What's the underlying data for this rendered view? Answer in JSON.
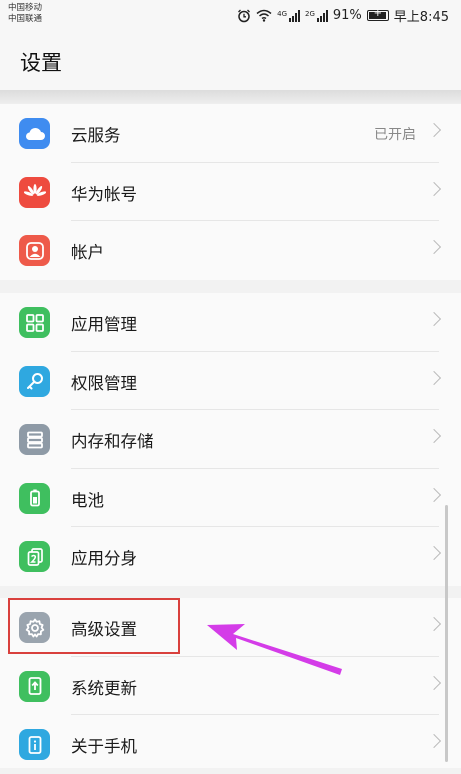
{
  "status_bar": {
    "carrier_1": "中国移动",
    "carrier_2": "中国联通",
    "sig1_tag": "4G",
    "sig2_tag": "2G",
    "battery_percent": "91%",
    "time": "早上8:45"
  },
  "header": {
    "title": "设置"
  },
  "groups": [
    {
      "items": [
        {
          "label": "云服务",
          "value": "已开启",
          "icon": "cloud-icon",
          "color": "#3f8cf0"
        },
        {
          "label": "华为帐号",
          "icon": "huawei-logo-icon",
          "color": "#ee4b3f"
        },
        {
          "label": "帐户",
          "icon": "account-icon",
          "color": "#ee5a4a"
        }
      ]
    },
    {
      "items": [
        {
          "label": "应用管理",
          "icon": "apps-grid-icon",
          "color": "#3fbf5f"
        },
        {
          "label": "权限管理",
          "icon": "key-icon",
          "color": "#2fa8e0"
        },
        {
          "label": "内存和存储",
          "icon": "storage-icon",
          "color": "#8e9aa6"
        },
        {
          "label": "电池",
          "icon": "battery-icon",
          "color": "#3fbf5f"
        },
        {
          "label": "应用分身",
          "icon": "app-twin-icon",
          "color": "#3fbf5f"
        }
      ]
    },
    {
      "items": [
        {
          "label": "高级设置",
          "icon": "gear-icon",
          "color": "#9aa4ae"
        },
        {
          "label": "系统更新",
          "icon": "system-update-icon",
          "color": "#3fbf5f"
        },
        {
          "label": "关于手机",
          "icon": "about-phone-icon",
          "color": "#2fa8e0"
        }
      ]
    }
  ]
}
